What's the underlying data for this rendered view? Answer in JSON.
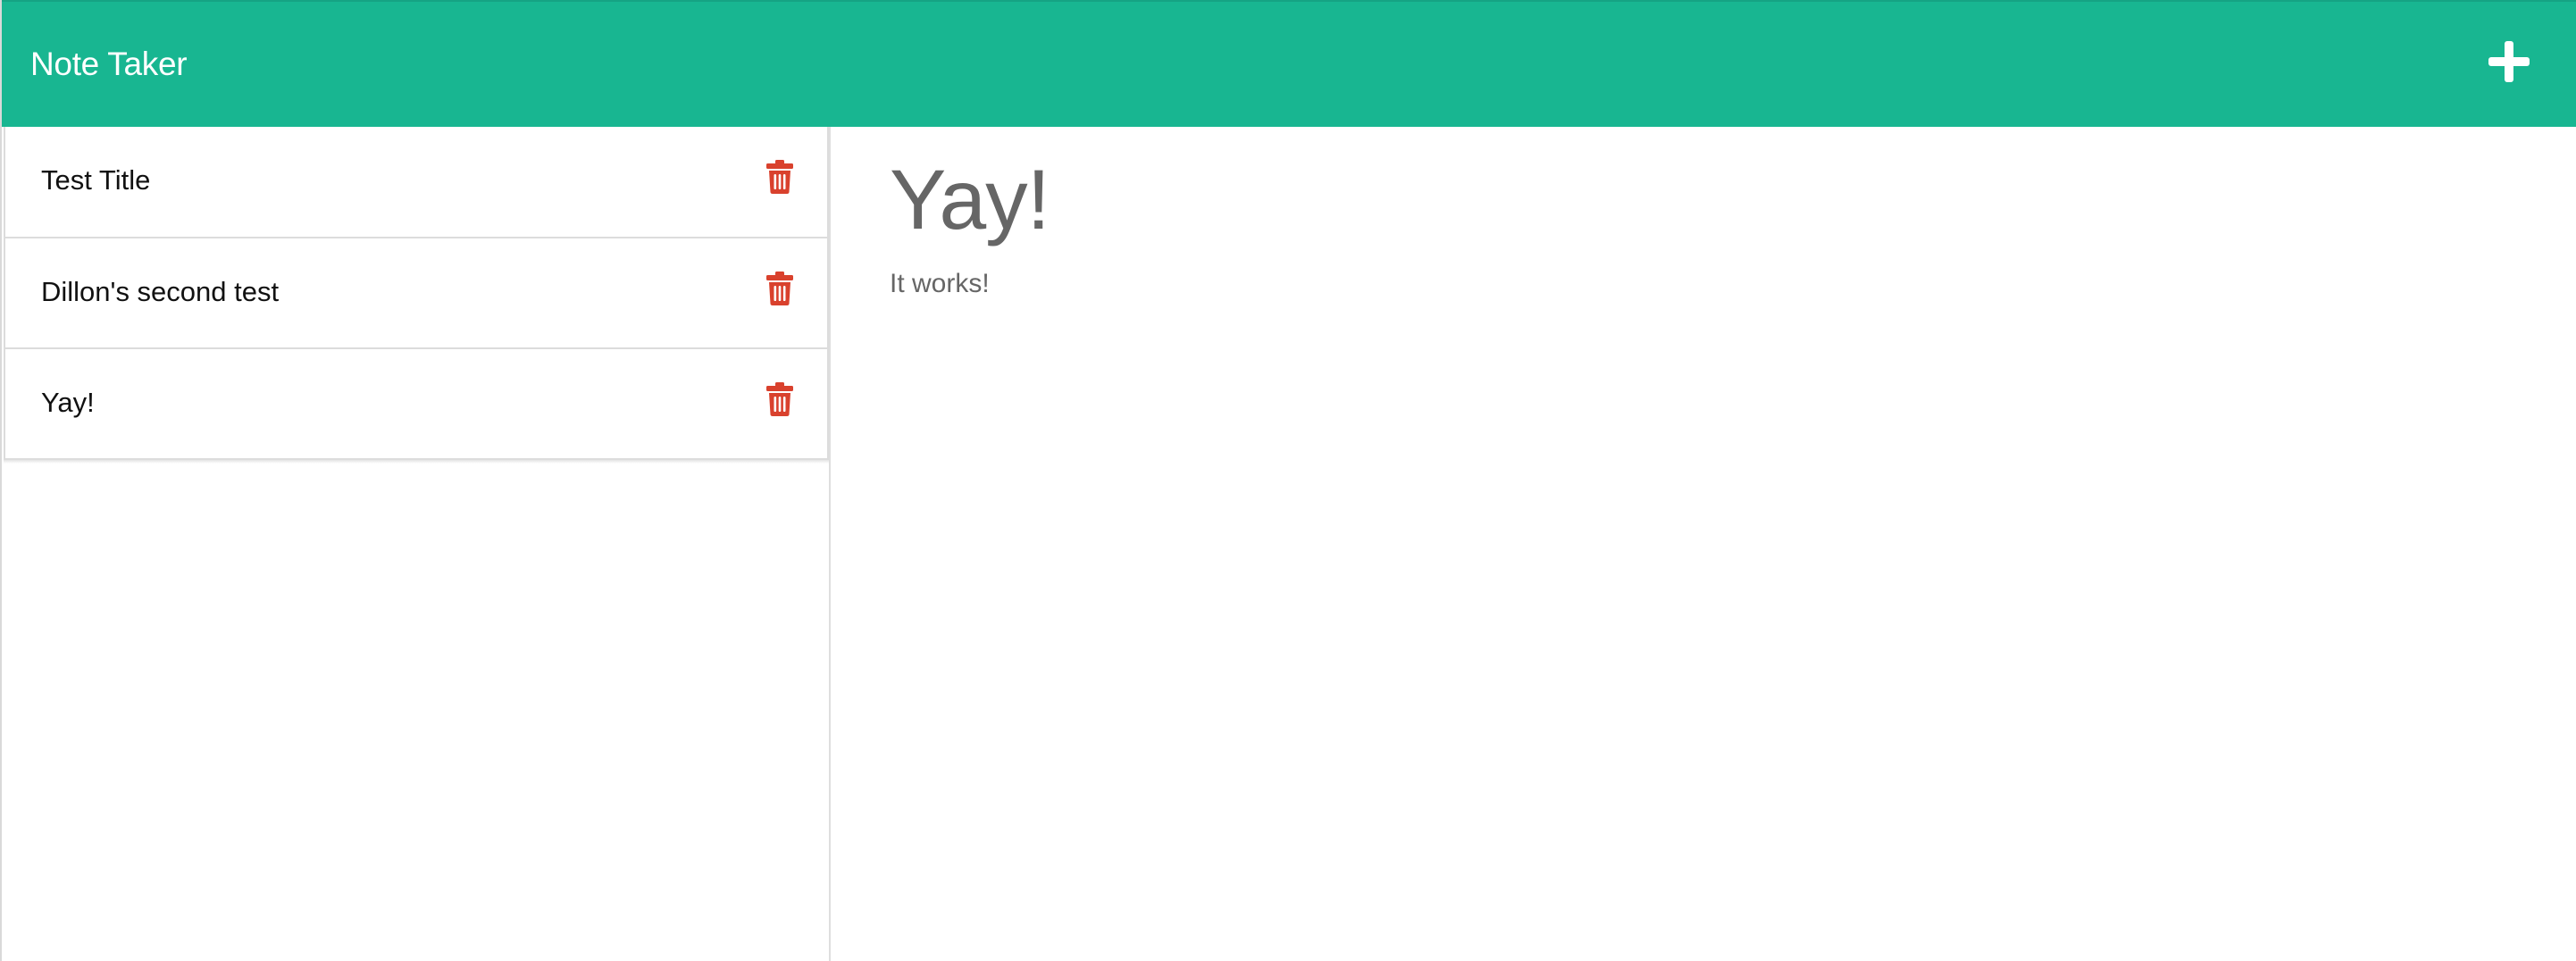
{
  "app": {
    "title": "Note Taker"
  },
  "toolbar": {
    "new_note_icon": "plus-icon"
  },
  "notes": [
    {
      "title": "Test Title",
      "delete_icon": "trash-icon"
    },
    {
      "title": "Dillon's second test",
      "delete_icon": "trash-icon"
    },
    {
      "title": "Yay!",
      "delete_icon": "trash-icon"
    }
  ],
  "active_note": {
    "title": "Yay!",
    "text": "It works!"
  },
  "colors": {
    "navbar": "#18b691",
    "delete": "#d9412d",
    "note_text": "#666666"
  }
}
